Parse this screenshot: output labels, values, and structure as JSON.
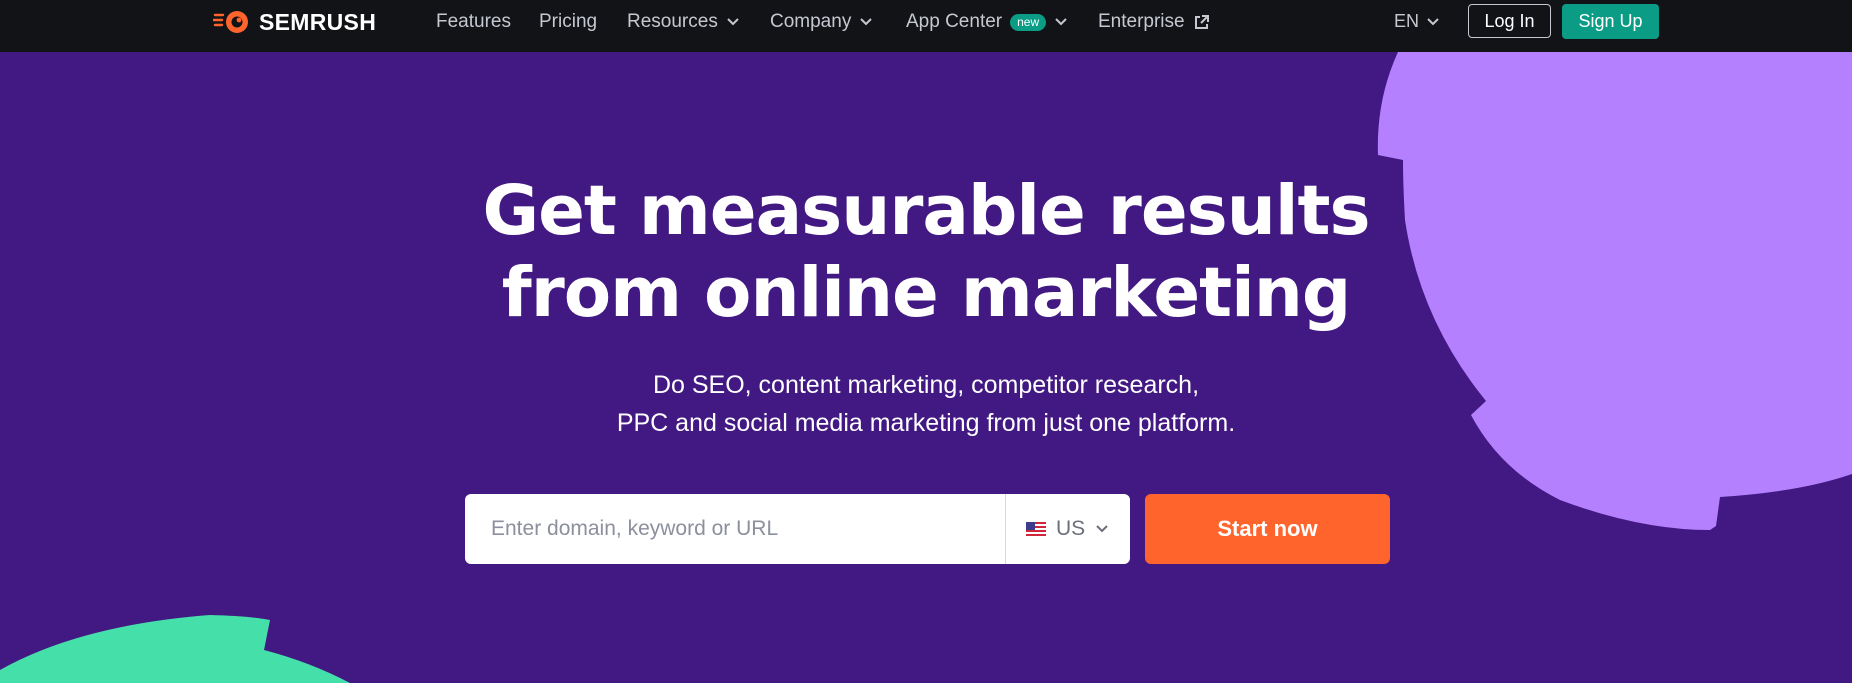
{
  "brand": {
    "name": "SEMRUSH",
    "logo_color": "#ff642d"
  },
  "nav": {
    "items": [
      {
        "label": "Features",
        "has_dropdown": false
      },
      {
        "label": "Pricing",
        "has_dropdown": false
      },
      {
        "label": "Resources",
        "has_dropdown": true
      },
      {
        "label": "Company",
        "has_dropdown": true
      },
      {
        "label": "App Center",
        "badge": "new",
        "has_dropdown": true
      },
      {
        "label": "Enterprise",
        "external": true
      }
    ],
    "language": "EN",
    "login_label": "Log In",
    "signup_label": "Sign Up"
  },
  "hero": {
    "title_line1": "Get measurable results",
    "title_line2": "from online marketing",
    "subtitle_line1": "Do SEO, content marketing, competitor research,",
    "subtitle_line2": "PPC and social media marketing from just one platform.",
    "search_placeholder": "Enter domain, keyword or URL",
    "database": "US",
    "database_flag_icon": "us-flag-icon",
    "cta_label": "Start now"
  },
  "colors": {
    "topbar": "#121316",
    "background": "#421983",
    "accent_orange": "#ff642d",
    "accent_green": "#0a9c85",
    "blob_purple": "#b580fe",
    "blob_green": "#45e0a9"
  }
}
